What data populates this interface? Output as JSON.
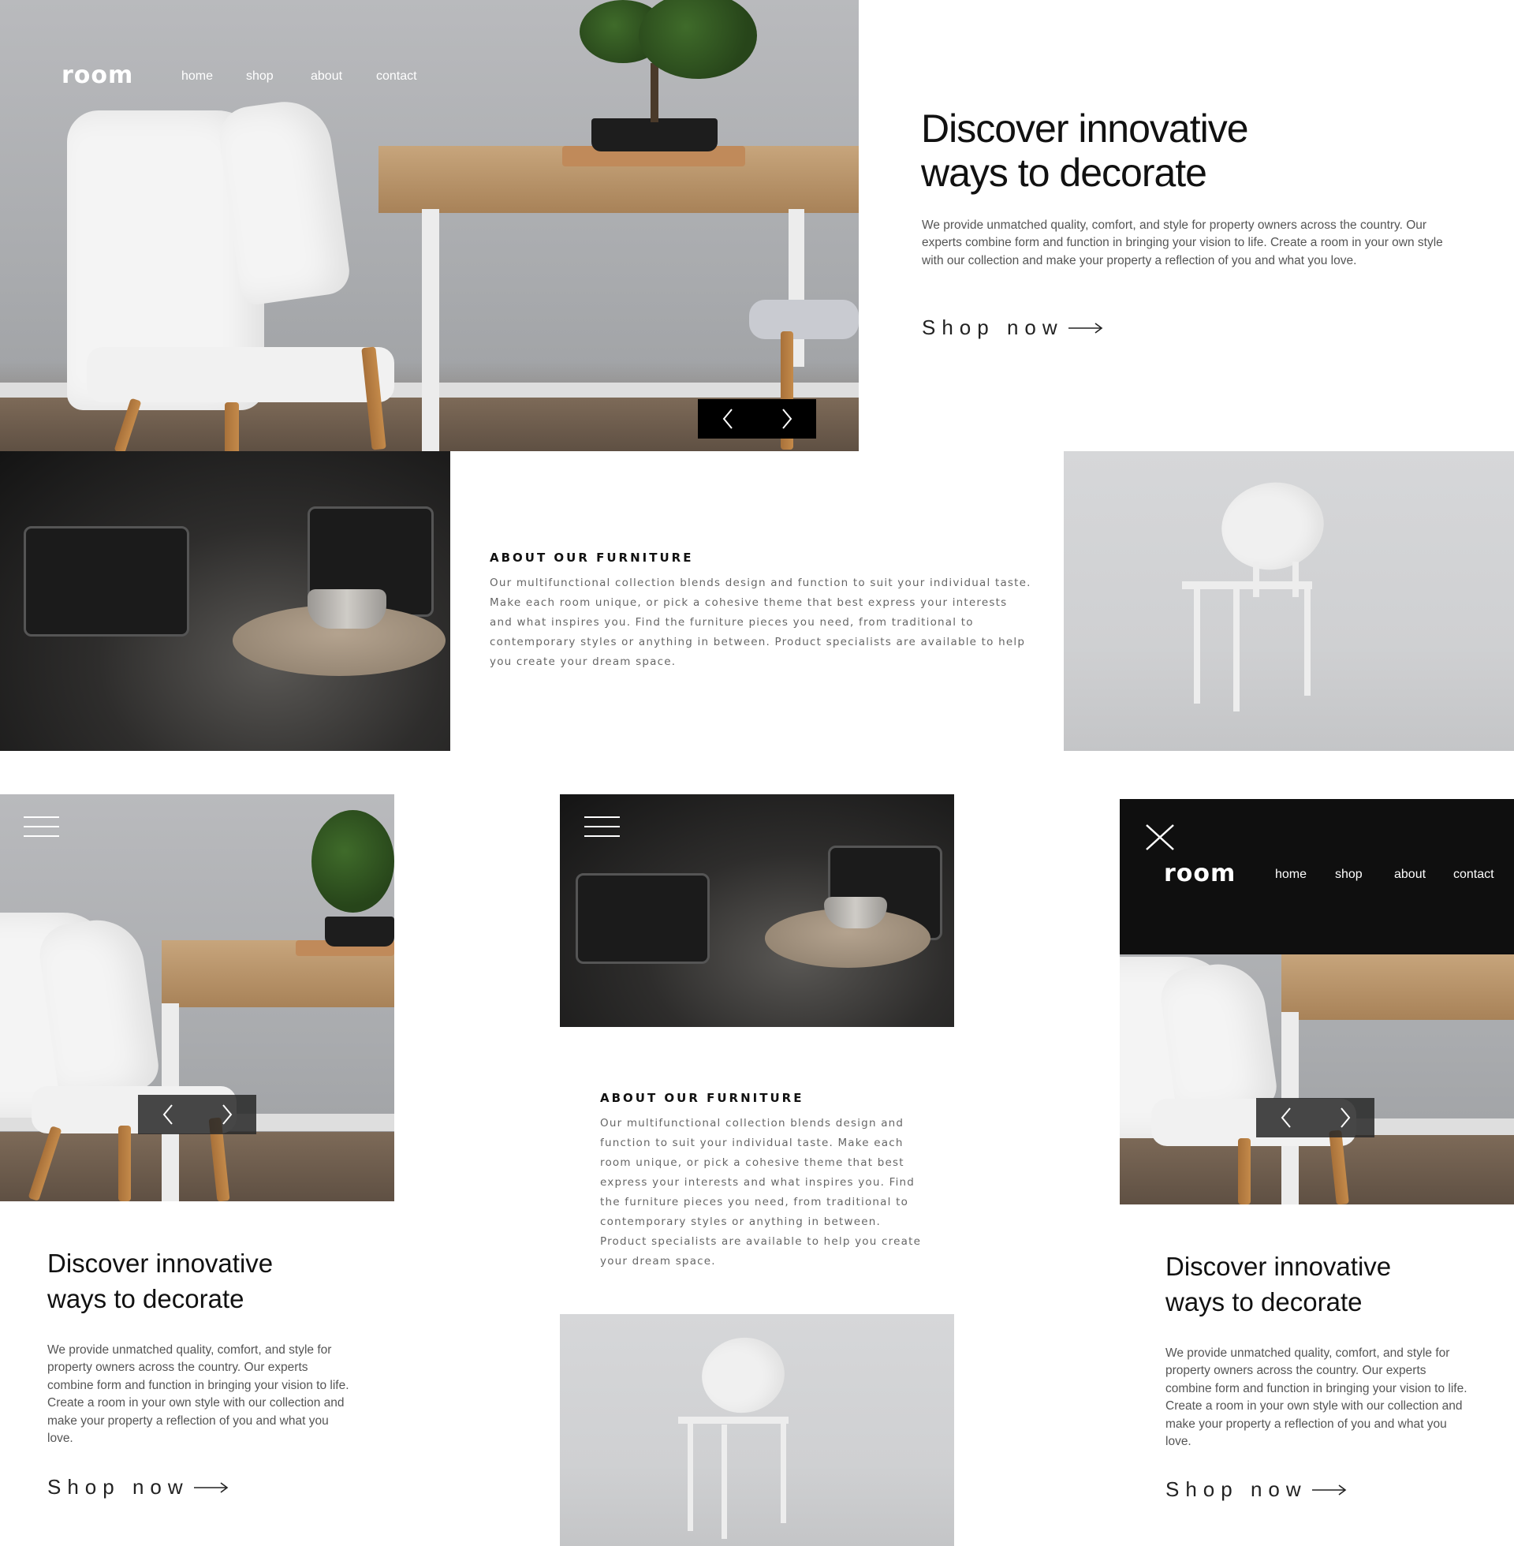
{
  "brand": {
    "logo": "room"
  },
  "nav": {
    "home": "home",
    "shop": "shop",
    "about": "about",
    "contact": "contact"
  },
  "hero": {
    "headline_line1": "Discover innovative",
    "headline_line2": "ways to decorate",
    "body": "We provide unmatched quality, comfort, and style for property owners across the country. Our experts combine form and function in bringing your vision to life. Create a room in your own style with our collection and make your property a reflection of you and what you love.",
    "cta": "Shop now"
  },
  "about": {
    "title": "ABOUT OUR FURNITURE",
    "body": "Our multifunctional collection blends design and function to suit your individual taste. Make each room unique, or pick a cohesive theme that best express your interests and what inspires you. Find the furniture pieces you need, from traditional to contemporary styles or anything in between. Product specialists are available to help you create your dream space."
  },
  "icons": {
    "prev": "chevron-left-icon",
    "next": "chevron-right-icon",
    "arrow": "arrow-right-icon",
    "menu": "hamburger-menu-icon",
    "close": "close-icon"
  },
  "colors": {
    "slider_bg": "#000000",
    "mobile_menu_bg": "#0f0f0f",
    "text_dark": "#111111",
    "text_muted": "#555555"
  }
}
